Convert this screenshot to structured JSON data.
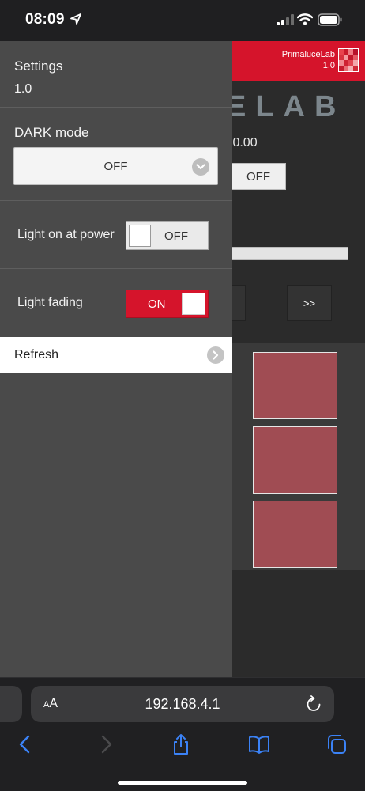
{
  "status_bar": {
    "time": "08:09"
  },
  "background_page": {
    "brand_name": "PrimaluceLab",
    "brand_version": "1.0",
    "logo_word_partial": "ELAB",
    "version_partial": ".0.00",
    "off_button": "OFF",
    "next_button": ">>"
  },
  "drawer": {
    "title": "Settings",
    "version": "1.0",
    "dark_mode": {
      "label": "DARK mode",
      "value": "OFF"
    },
    "light_on_at_power": {
      "label": "Light on at power",
      "state": "OFF"
    },
    "light_fading": {
      "label": "Light fading",
      "state": "ON"
    },
    "refresh": {
      "label": "Refresh"
    }
  },
  "safari": {
    "text_size_label_small": "A",
    "text_size_label_large": "A",
    "url": "192.168.4.1"
  },
  "colors": {
    "accent_red": "#d5142b",
    "drawer_bg": "#4a4a4a",
    "tile": "#a04c53"
  }
}
